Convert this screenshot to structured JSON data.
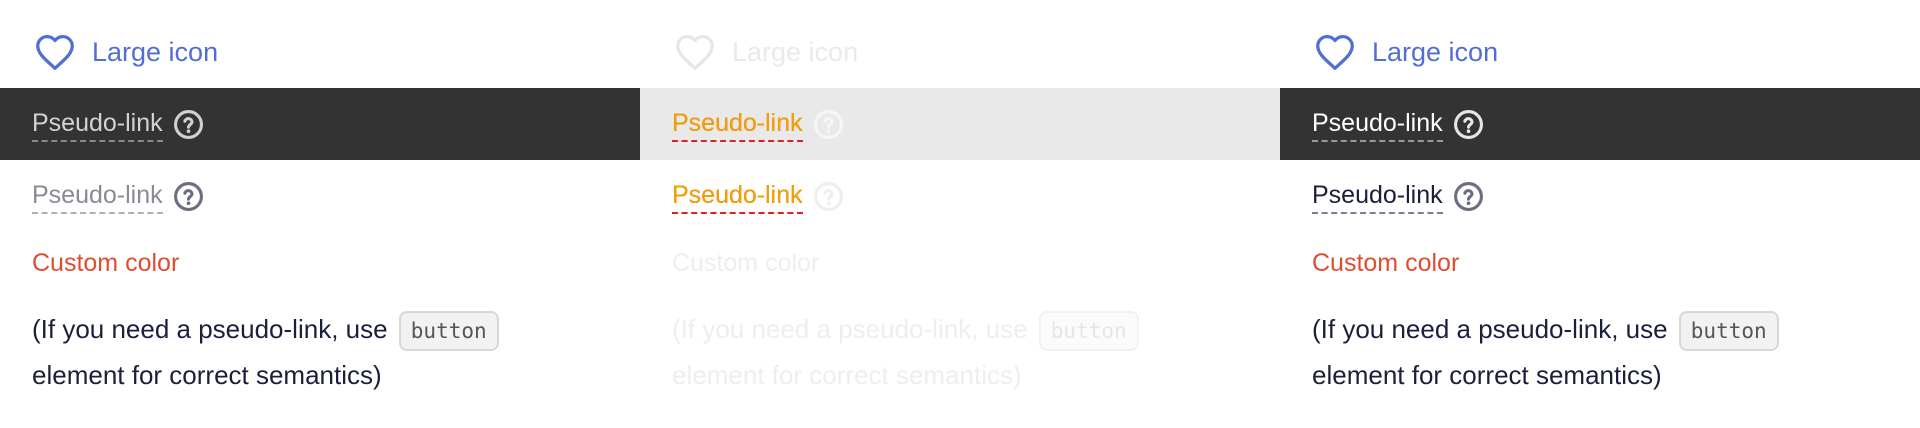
{
  "colors": {
    "accent": "#526ed3",
    "custom": "#e04c2d",
    "dark_row": "#333333",
    "hover_text": "#f0a000",
    "hover_underline": "#e02020"
  },
  "panels": [
    {
      "large_icon": {
        "icon": "heart-icon",
        "label": "Large icon"
      },
      "pseudo_dark": {
        "label": "Pseudo-link",
        "icon": "question-circle-icon"
      },
      "pseudo_light": {
        "label": "Pseudo-link",
        "icon": "question-circle-icon"
      },
      "custom_color": "Custom color",
      "note": {
        "before": "(If you need a pseudo-link, use ",
        "code": "button",
        "after": " element for correct semantics)"
      }
    },
    {
      "large_icon": {
        "icon": "heart-icon",
        "label": "Large icon"
      },
      "pseudo_dark": {
        "label": "Pseudo-link",
        "icon": "question-circle-icon"
      },
      "pseudo_light": {
        "label": "Pseudo-link",
        "icon": "question-circle-icon"
      },
      "custom_color": "Custom color",
      "note": {
        "before": "(If you need a pseudo-link, use ",
        "code": "button",
        "after": " element for correct semantics)"
      }
    },
    {
      "large_icon": {
        "icon": "heart-icon",
        "label": "Large icon"
      },
      "pseudo_dark": {
        "label": "Pseudo-link",
        "icon": "question-circle-icon"
      },
      "pseudo_light": {
        "label": "Pseudo-link",
        "icon": "question-circle-icon"
      },
      "custom_color": "Custom color",
      "note": {
        "before": "(If you need a pseudo-link, use ",
        "code": "button",
        "after": " element for correct semantics)"
      }
    }
  ]
}
